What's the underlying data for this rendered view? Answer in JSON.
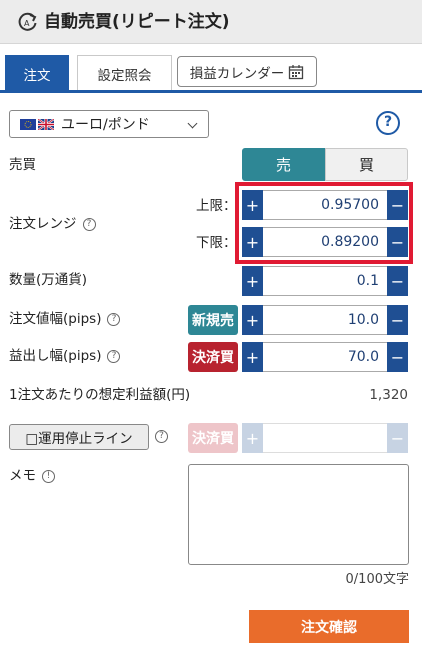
{
  "header": {
    "title": "自動売買(リピート注文)",
    "icon": "repeat-arrow-icon"
  },
  "tabs": {
    "order": "注文",
    "settings": "設定照会",
    "calendar": "損益カレンダー",
    "calendar_icon": "calendar-icon"
  },
  "currency": {
    "pair": "ユーロ/ポンド",
    "flag_icons": [
      "eu-flag-icon",
      "uk-flag-icon"
    ]
  },
  "side": {
    "label": "売買",
    "sell": "売",
    "buy": "買",
    "selected": "sell"
  },
  "range": {
    "label": "注文レンジ",
    "upper_label": "上限：",
    "upper_value": "0.95700",
    "lower_label": "下限：",
    "lower_value": "0.89200"
  },
  "quantity": {
    "label": "数量(万通貨)",
    "value": "0.1"
  },
  "order_width": {
    "label": "注文値幅(pips)",
    "badge": "新規売",
    "value": "10.0"
  },
  "profit_width": {
    "label": "益出し幅(pips)",
    "badge": "決済買",
    "value": "70.0"
  },
  "expected_profit": {
    "label": "1注文あたりの想定利益額(円)",
    "value": "1,320"
  },
  "stop_line": {
    "label": "□運用停止ライン",
    "badge": "決済買",
    "value": ""
  },
  "memo": {
    "label": "メモ",
    "counter": "0/100文字"
  },
  "confirm": {
    "label": "注文確認"
  },
  "symbols": {
    "plus": "+",
    "minus": "−",
    "help": "?",
    "info": "!"
  },
  "colors": {
    "primary": "#1f5aa6",
    "sell": "#2e8795",
    "new_sell_badge": "#2e8795",
    "close_buy_badge": "#b8232f",
    "confirm": "#e96c2b",
    "highlight": "#e01a33"
  }
}
